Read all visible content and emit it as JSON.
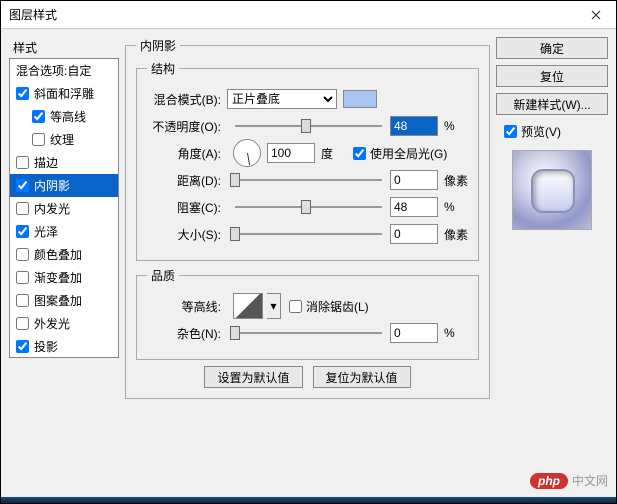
{
  "window": {
    "title": "图层样式"
  },
  "styles": {
    "header": "样式",
    "items": [
      {
        "label": "混合选项:自定",
        "checkbox": false,
        "indent": false
      },
      {
        "label": "斜面和浮雕",
        "checkbox": true,
        "checked": true,
        "indent": false
      },
      {
        "label": "等高线",
        "checkbox": true,
        "checked": true,
        "indent": true
      },
      {
        "label": "纹理",
        "checkbox": true,
        "checked": false,
        "indent": true
      },
      {
        "label": "描边",
        "checkbox": true,
        "checked": false,
        "indent": false
      },
      {
        "label": "内阴影",
        "checkbox": true,
        "checked": true,
        "indent": false,
        "selected": true
      },
      {
        "label": "内发光",
        "checkbox": true,
        "checked": false,
        "indent": false
      },
      {
        "label": "光泽",
        "checkbox": true,
        "checked": true,
        "indent": false
      },
      {
        "label": "颜色叠加",
        "checkbox": true,
        "checked": false,
        "indent": false
      },
      {
        "label": "渐变叠加",
        "checkbox": true,
        "checked": false,
        "indent": false
      },
      {
        "label": "图案叠加",
        "checkbox": true,
        "checked": false,
        "indent": false
      },
      {
        "label": "外发光",
        "checkbox": true,
        "checked": false,
        "indent": false
      },
      {
        "label": "投影",
        "checkbox": true,
        "checked": true,
        "indent": false
      }
    ]
  },
  "panel": {
    "title": "内阴影",
    "structure": {
      "legend": "结构",
      "blend_label": "混合模式(B):",
      "blend_value": "正片叠底",
      "swatch_color": "#a8c4f0",
      "opacity_label": "不透明度(O):",
      "opacity_value": "48",
      "opacity_unit": "%",
      "angle_label": "角度(A):",
      "angle_value": "100",
      "angle_unit": "度",
      "global_light_label": "使用全局光(G)",
      "global_light_checked": true,
      "distance_label": "距离(D):",
      "distance_value": "0",
      "distance_unit": "像素",
      "choke_label": "阻塞(C):",
      "choke_value": "48",
      "choke_unit": "%",
      "size_label": "大小(S):",
      "size_value": "0",
      "size_unit": "像素"
    },
    "quality": {
      "legend": "品质",
      "contour_label": "等高线:",
      "antialias_label": "消除锯齿(L)",
      "antialias_checked": false,
      "noise_label": "杂色(N):",
      "noise_value": "0",
      "noise_unit": "%"
    },
    "buttons": {
      "default_set": "设置为默认值",
      "default_reset": "复位为默认值"
    }
  },
  "right": {
    "ok": "确定",
    "reset": "复位",
    "new_style": "新建样式(W)...",
    "preview_label": "预览(V)",
    "preview_checked": true
  },
  "watermark": {
    "badge": "php",
    "text": "中文网"
  }
}
